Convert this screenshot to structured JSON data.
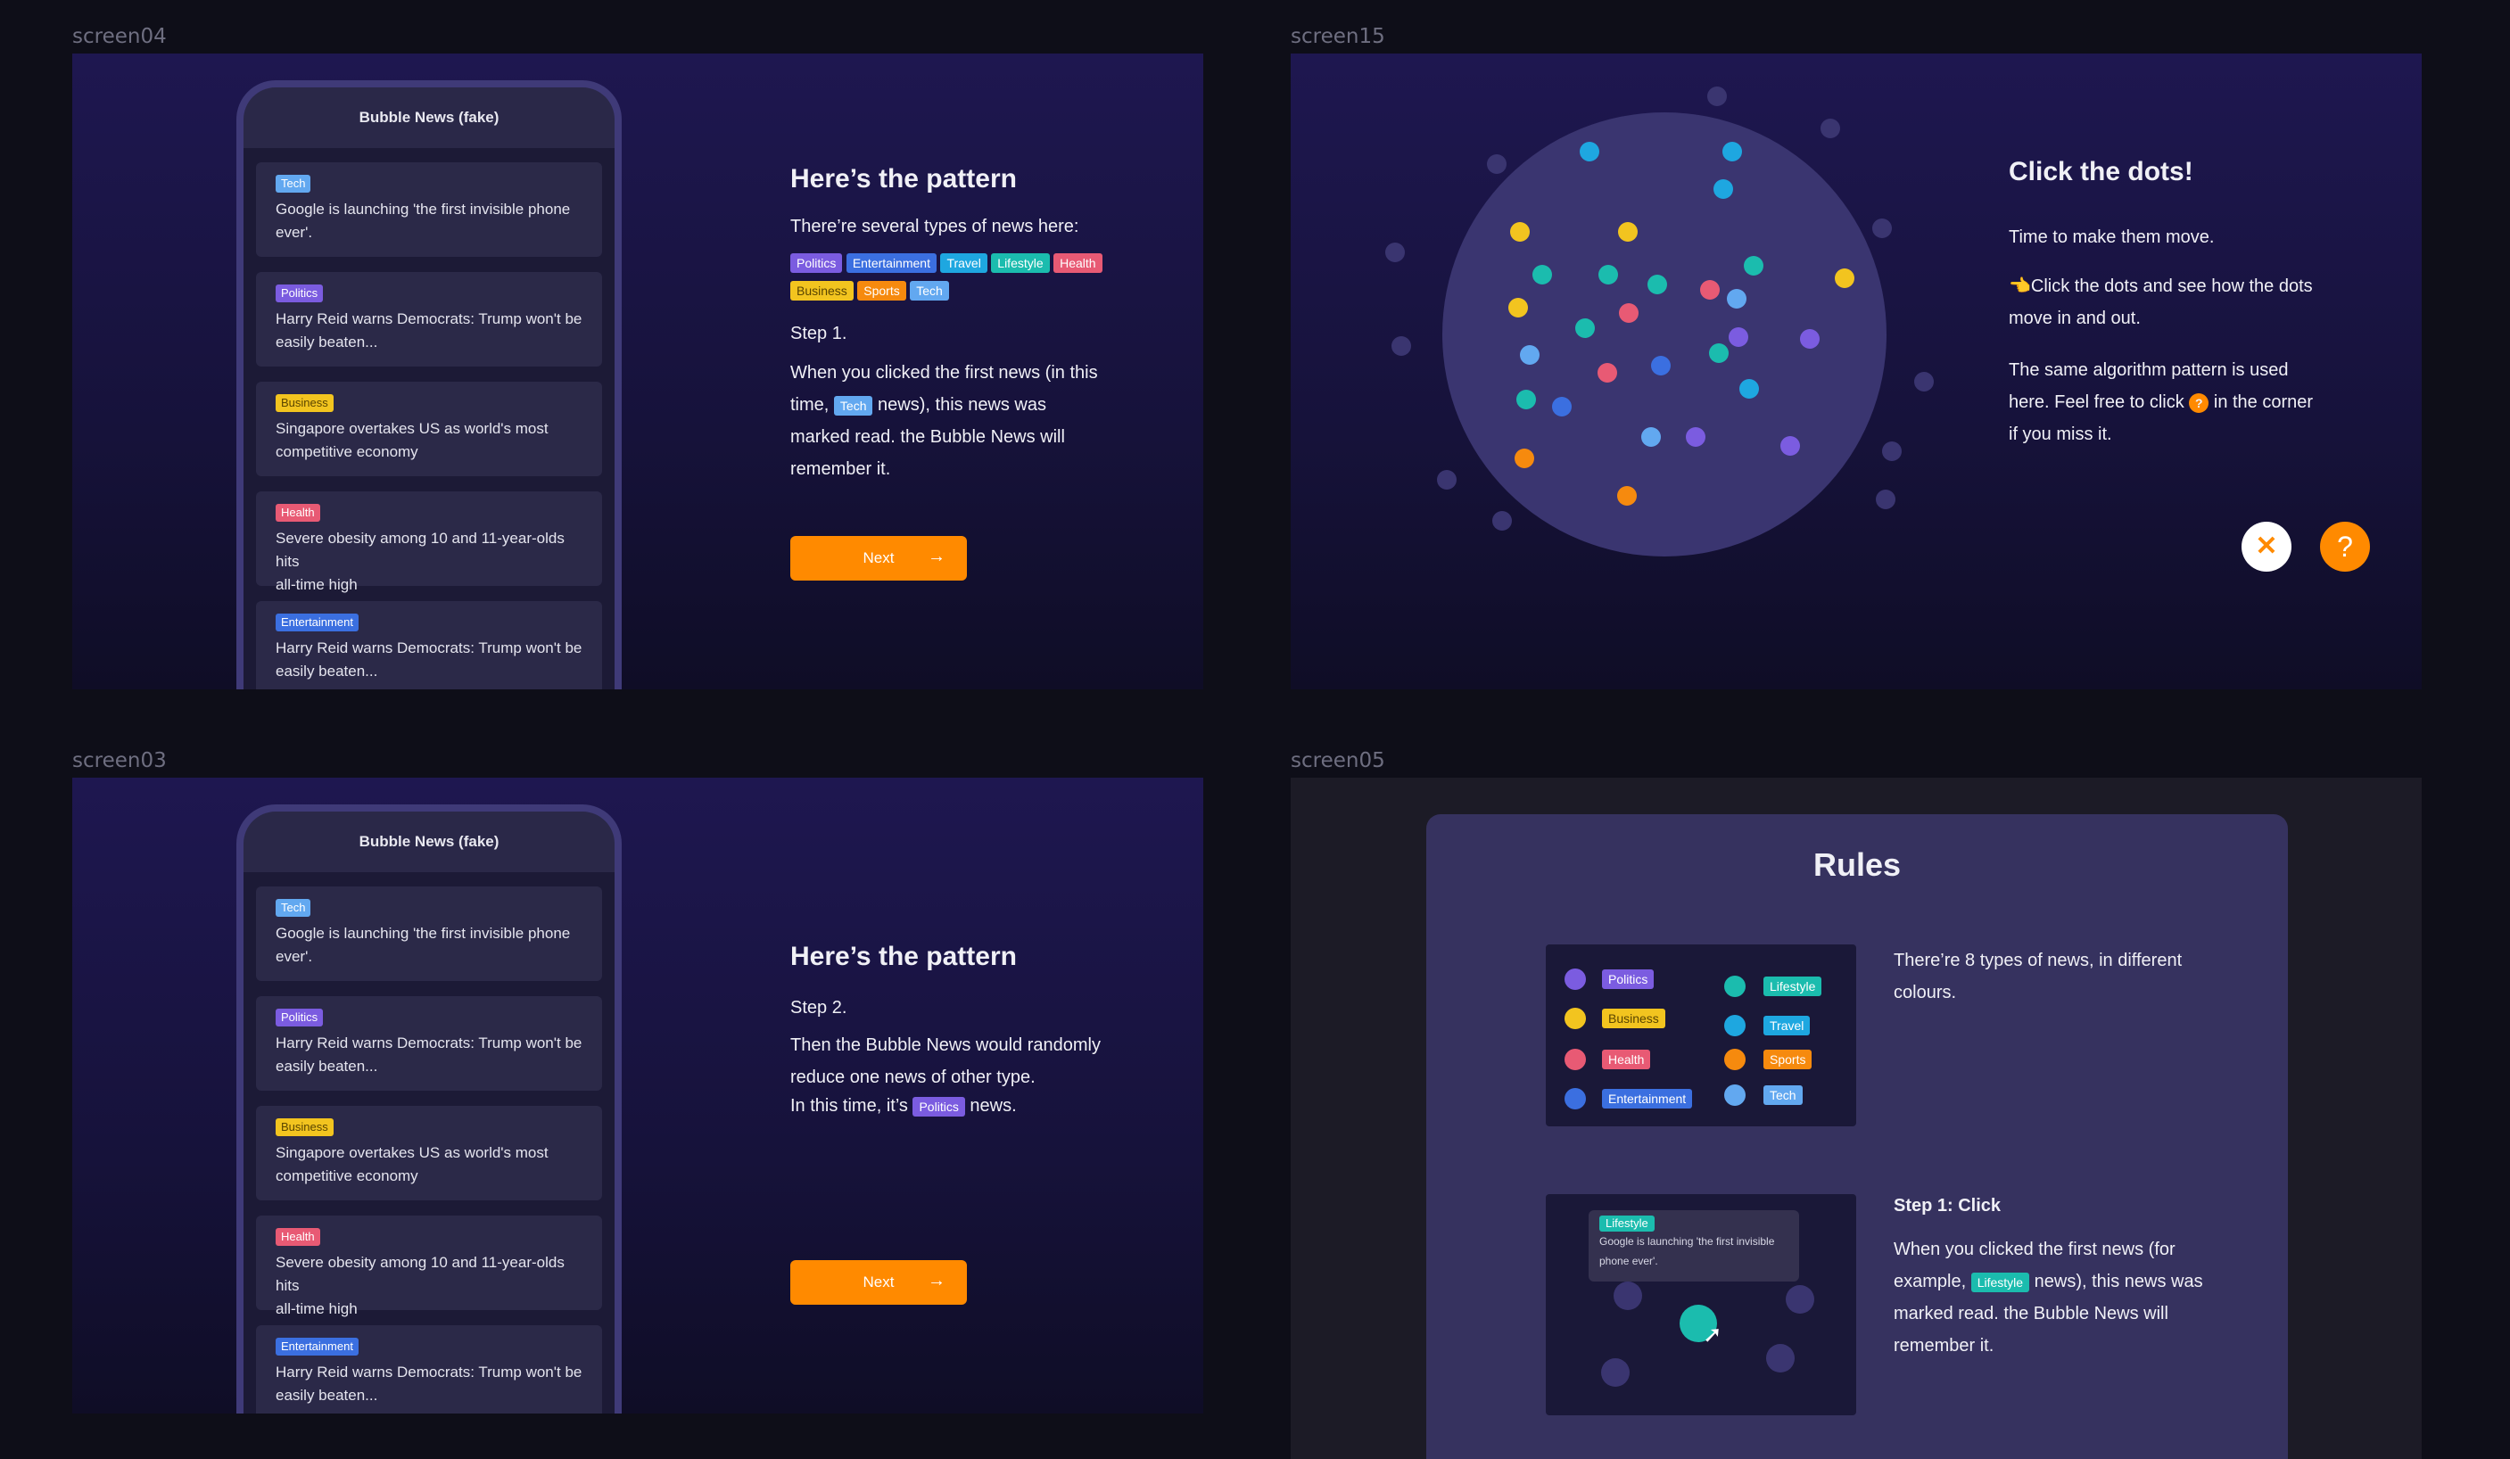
{
  "screens": {
    "s04": {
      "label": "screen04",
      "title": "Here’s the pattern",
      "intro": "There’re several types of news here:",
      "step": "Step 1.",
      "body_a": "When you clicked the first news (in this",
      "body_b": "time,",
      "body_c": "news), this news was",
      "body_d": "marked read. the Bubble News will",
      "body_e": "remember it.",
      "next": "Next"
    },
    "s15": {
      "label": "screen15",
      "title": "Click the dots!",
      "p1": "Time to make them move.",
      "p2a": "👈Click the dots and see how the dots",
      "p2b": "move in and out.",
      "p3a": "The same algorithm pattern is used",
      "p3b": "here. Feel free to click",
      "p3c": "in the corner",
      "p3d": "if you miss it.",
      "close_icon": "✕",
      "help_icon": "?"
    },
    "s03": {
      "label": "screen03",
      "title": "Here’s the pattern",
      "step": "Step 2.",
      "body_a": "Then the Bubble News would randomly",
      "body_b": "reduce one news of other type.",
      "body_c": "In this time, it’s",
      "body_d": "news.",
      "next": "Next"
    },
    "s05": {
      "label": "screen05",
      "title": "Rules",
      "types_a": "There’re 8 types of news, in different",
      "types_b": "colours.",
      "step_title": "Step 1: Click",
      "step_a": "When you clicked the first news (for",
      "step_b": "example,",
      "step_c": "news), this news was",
      "step_d": "marked read. the Bubble News will",
      "step_e": "remember it.",
      "tooltip_tag": "Lifestyle",
      "tooltip_a": "Google is launching 'the first invisible",
      "tooltip_b": "phone ever'."
    }
  },
  "phone": {
    "title": "Bubble News (fake)",
    "cards": [
      {
        "tag": "Tech",
        "l1": "Google is launching 'the first invisible phone",
        "l2": "ever'."
      },
      {
        "tag": "Politics",
        "l1": "Harry Reid warns Democrats: Trump won't be",
        "l2": "easily beaten..."
      },
      {
        "tag": "Business",
        "l1": "Singapore overtakes US as world's most",
        "l2": "competitive economy"
      },
      {
        "tag": "Health",
        "l1": "Severe obesity among 10 and 11-year-olds hits",
        "l2": "all-time high"
      },
      {
        "tag": "Entertainment",
        "l1": "Harry Reid warns Democrats: Trump won't be",
        "l2": "easily beaten..."
      }
    ]
  },
  "types": {
    "politics": "Politics",
    "entertainment": "Entertainment",
    "travel": "Travel",
    "lifestyle": "Lifestyle",
    "health": "Health",
    "business": "Business",
    "sports": "Sports",
    "tech": "Tech"
  },
  "colors": {
    "politics": "#7b5ce0",
    "entertainment": "#3b6fe0",
    "travel": "#1ea7e0",
    "lifestyle": "#1bbcae",
    "health": "#e85a74",
    "business": "#f2c41f",
    "sports": "#f68a0e",
    "tech": "#62a8f0",
    "accent": "#ff8a00"
  }
}
